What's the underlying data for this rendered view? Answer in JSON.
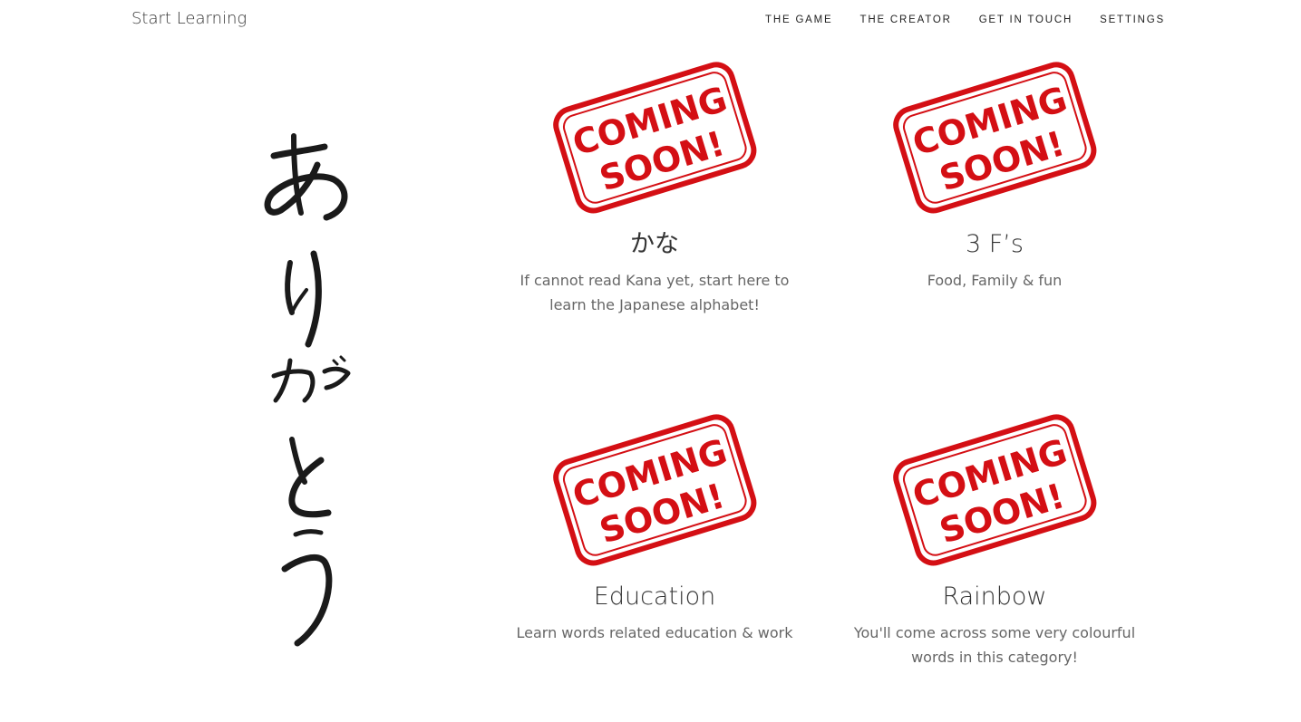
{
  "brand": "Start Learning",
  "nav": [
    {
      "label": "THE GAME"
    },
    {
      "label": "THE CREATOR"
    },
    {
      "label": "GET IN TOUCH"
    },
    {
      "label": "SETTINGS"
    }
  ],
  "hero": {
    "calligraphy_text": "ありがとう"
  },
  "stamp": {
    "line1": "COMING",
    "line2": "SOON!",
    "color": "#d40f14"
  },
  "cards": [
    {
      "title": "かな",
      "description": "If cannot read Kana yet, start here to learn the Japanese alphabet!"
    },
    {
      "title": "3 F’s",
      "description": "Food, Family & fun"
    },
    {
      "title": "Education",
      "description": "Learn words related education & work"
    },
    {
      "title": "Rainbow",
      "description": "You'll come across some very colourful words in this category!"
    }
  ]
}
